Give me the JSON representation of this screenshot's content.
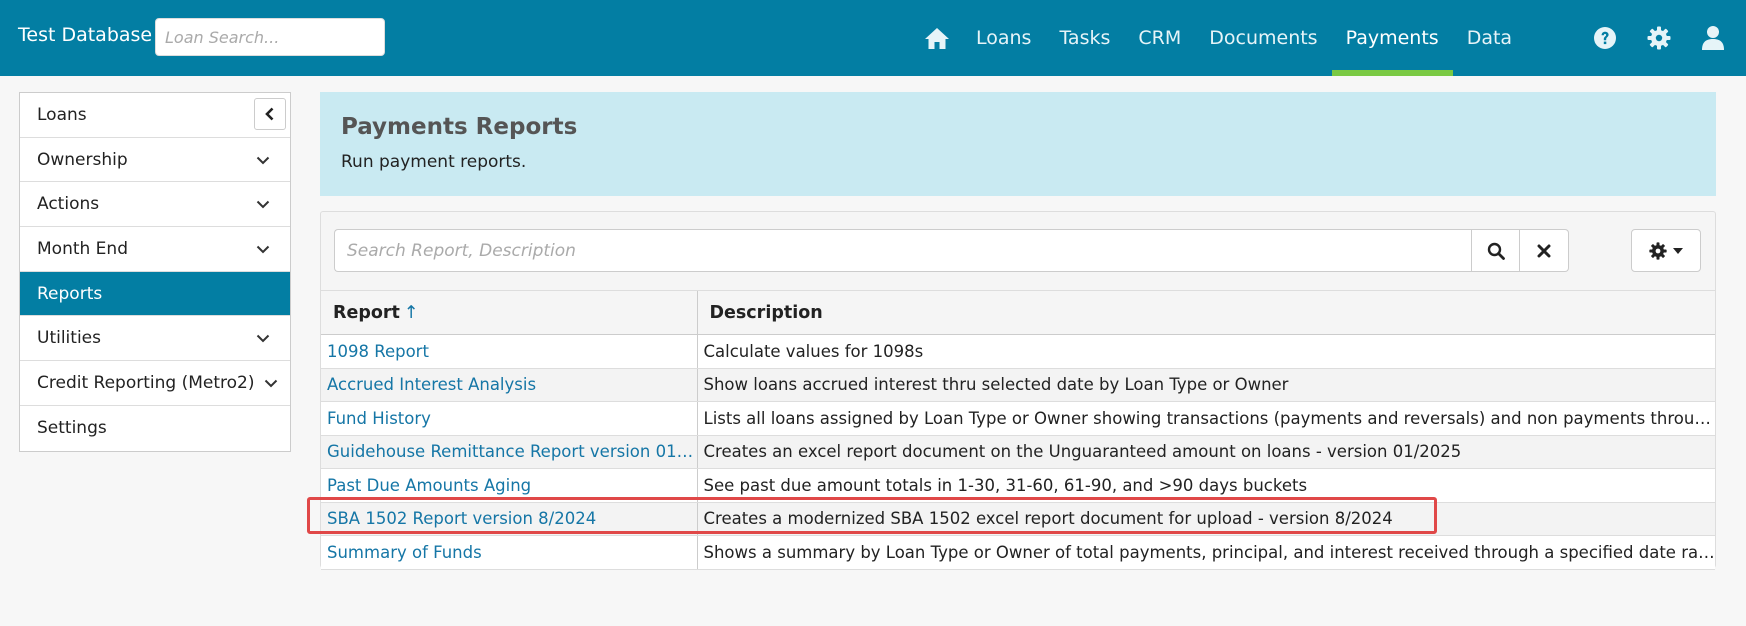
{
  "app": {
    "brand": "Test Database",
    "loan_search_placeholder": "Loan Search..."
  },
  "nav": {
    "items": [
      {
        "label": "Loans"
      },
      {
        "label": "Tasks"
      },
      {
        "label": "CRM"
      },
      {
        "label": "Documents"
      },
      {
        "label": "Payments",
        "active": true
      },
      {
        "label": "Data"
      }
    ],
    "icons": [
      "home-icon",
      "help-icon",
      "gear-icon",
      "user-icon"
    ]
  },
  "sidebar": {
    "items": [
      {
        "label": "Loans"
      },
      {
        "label": "Ownership"
      },
      {
        "label": "Actions"
      },
      {
        "label": "Month End"
      },
      {
        "label": "Reports",
        "active": true
      },
      {
        "label": "Utilities"
      },
      {
        "label": "Credit Reporting (Metro2)"
      },
      {
        "label": "Settings"
      }
    ]
  },
  "header": {
    "title": "Payments Reports",
    "subtitle": "Run payment reports."
  },
  "search": {
    "placeholder": "Search Report, Description"
  },
  "table": {
    "columns": [
      "Report",
      "Description"
    ],
    "sort_indicator": "↑",
    "rows": [
      {
        "report": "1098 Report",
        "description": "Calculate values for 1098s"
      },
      {
        "report": "Accrued Interest Analysis",
        "description": "Show loans accrued interest thru selected date by Loan Type or Owner"
      },
      {
        "report": "Fund History",
        "description": "Lists all loans assigned by Loan Type or Owner showing transactions (payments and reversals) and non payments through th..."
      },
      {
        "report": "Guidehouse Remittance Report version 01/...",
        "description": "Creates an excel report document on the Unguaranteed amount on loans - version 01/2025"
      },
      {
        "report": "Past Due Amounts Aging",
        "description": "See past due amount totals in 1-30, 31-60, 61-90, and >90 days buckets"
      },
      {
        "report": "SBA 1502 Report version 8/2024",
        "description": "Creates a modernized SBA 1502 excel report document for upload - version 8/2024",
        "highlighted": true
      },
      {
        "report": "Summary of Funds",
        "description": "Shows a summary by Loan Type or Owner of total payments, principal, and interest received through a specified date range"
      }
    ]
  },
  "colors": {
    "topbar": "#037ea3",
    "active_underline": "#7ac943",
    "header_panel": "#c9eaf2",
    "link": "#1576a6",
    "highlight": "#e04848"
  }
}
